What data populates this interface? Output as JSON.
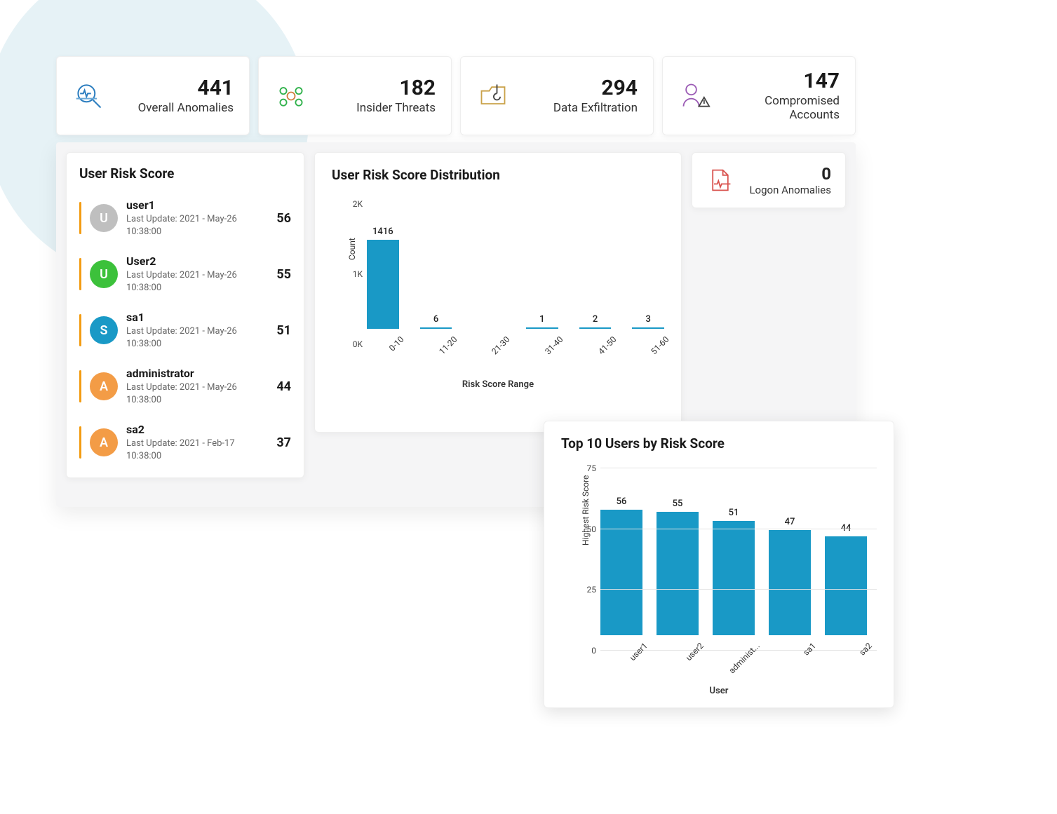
{
  "metrics": [
    {
      "label": "Overall Anomalies",
      "value": "441",
      "iconColor": "#2b7dbf"
    },
    {
      "label": "Insider Threats",
      "value": "182",
      "iconColor": "#2fb14a"
    },
    {
      "label": "Data Exfiltration",
      "value": "294",
      "iconColor": "#d9a441"
    },
    {
      "label": "Compromised Accounts",
      "value": "147",
      "iconColor": "#9b5bb5"
    }
  ],
  "logon": {
    "label": "Logon Anomalies",
    "value": "0"
  },
  "userRisk": {
    "title": "User Risk Score",
    "items": [
      {
        "initial": "U",
        "name": "user1",
        "sub": "Last Update: 2021 - May-26 10:38:00",
        "score": "56",
        "color": "#bfbfbf"
      },
      {
        "initial": "U",
        "name": "User2",
        "sub": "Last Update: 2021 - May-26 10:38:00",
        "score": "55",
        "color": "#3cc13b"
      },
      {
        "initial": "S",
        "name": "sa1",
        "sub": "Last Update: 2021 - May-26 10:38:00",
        "score": "51",
        "color": "#1999c6"
      },
      {
        "initial": "A",
        "name": "administrator",
        "sub": "Last Update: 2021 - May-26 10:38:00",
        "score": "44",
        "color": "#f39c46"
      },
      {
        "initial": "A",
        "name": "sa2",
        "sub": "Last Update: 2021 - Feb-17 10:38:00",
        "score": "37",
        "color": "#f39c46"
      }
    ]
  },
  "dist": {
    "title": "User Risk Score Distribution",
    "ylabel": "Count",
    "xlabel": "Risk Score Range",
    "yticks": [
      "0K",
      "1K",
      "2K"
    ]
  },
  "top10": {
    "title": "Top 10 Users by Risk Score",
    "ylabel": "Highest Risk Score",
    "xlabel": "User",
    "yticks": [
      "0",
      "25",
      "50",
      "75"
    ]
  },
  "chart_data": [
    {
      "id": "distribution",
      "type": "bar",
      "title": "User Risk Score Distribution",
      "xlabel": "Risk Score Range",
      "ylabel": "Count",
      "categories": [
        "0-10",
        "11-20",
        "21-30",
        "31-40",
        "41-50",
        "51-60"
      ],
      "values": [
        1416,
        6,
        0,
        1,
        2,
        3
      ],
      "ylim": [
        0,
        2000
      ]
    },
    {
      "id": "top10",
      "type": "bar",
      "title": "Top 10 Users by Risk Score",
      "xlabel": "User",
      "ylabel": "Highest Risk Score",
      "categories": [
        "user1",
        "user2",
        "administ...",
        "sa1",
        "sa2"
      ],
      "values": [
        56,
        55,
        51,
        47,
        44
      ],
      "ylim": [
        0,
        75
      ]
    }
  ]
}
